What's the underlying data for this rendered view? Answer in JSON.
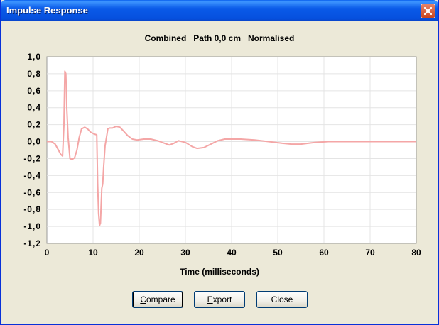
{
  "window": {
    "title": "Impulse Response"
  },
  "chart_header": "Combined   Path 0,0 cm   Normalised",
  "buttons": {
    "compare": {
      "label": "Compare",
      "accel": "C",
      "rest": "ompare"
    },
    "export": {
      "label": "Export",
      "accel": "E",
      "rest": "xport"
    },
    "close": {
      "label": "Close"
    }
  },
  "colors": {
    "titlebar": "#0a5ae8",
    "dialog_bg": "#ece9d8",
    "trace": "#f4a6a6",
    "grid": "#e4e4e4"
  },
  "icons": {
    "close": "close-x-icon"
  },
  "chart_data": {
    "type": "line",
    "xlabel": "Time (milliseconds)",
    "ylabel": "",
    "xlim": [
      0,
      80
    ],
    "ylim": [
      -1.2,
      1.0
    ],
    "x_ticks": [
      "0",
      "10",
      "20",
      "30",
      "40",
      "50",
      "60",
      "70",
      "80"
    ],
    "y_ticks": [
      "1,0",
      "0,8",
      "0,6",
      "0,4",
      "0,2",
      "0,0",
      "-0,2",
      "-0,4",
      "-0,6",
      "-0,8",
      "-1,0",
      "-1,2"
    ],
    "grid": true,
    "series": [
      {
        "x": [
          0,
          1,
          1.8,
          2.5,
          3,
          3.4,
          3.7,
          3.9,
          4.1,
          4.3,
          4.6,
          5.0,
          5.5,
          6.0,
          6.5,
          7.0,
          7.5,
          8.2,
          8.8,
          9.5,
          10.2,
          10.8,
          11.0,
          11.2,
          11.4,
          11.6,
          11.9,
          12.1,
          12.3,
          12.6,
          12.9,
          13.2,
          13.6,
          14.2,
          15.0,
          15.8,
          16.5,
          17.5,
          18.5,
          19.5,
          21.0,
          22.5,
          24.0,
          25.5,
          26.5,
          27.5,
          28.5,
          30.0,
          31.5,
          32.5,
          34.0,
          35.5,
          37.0,
          38.5,
          40.0,
          42.0,
          45.0,
          48.0,
          51.0,
          53.0,
          55.0,
          58.0,
          61.0,
          65.0,
          70.0,
          75.0,
          80.0
        ],
        "y": [
          0.0,
          0.0,
          -0.03,
          -0.1,
          -0.15,
          -0.17,
          0.2,
          0.83,
          0.8,
          0.4,
          0.05,
          -0.2,
          -0.21,
          -0.19,
          -0.1,
          0.05,
          0.15,
          0.17,
          0.15,
          0.11,
          0.09,
          0.08,
          -0.5,
          -0.85,
          -0.99,
          -0.96,
          -0.55,
          -0.5,
          -0.3,
          -0.05,
          0.05,
          0.15,
          0.16,
          0.16,
          0.18,
          0.17,
          0.13,
          0.07,
          0.03,
          0.02,
          0.03,
          0.03,
          0.01,
          -0.02,
          -0.04,
          -0.02,
          0.01,
          -0.01,
          -0.06,
          -0.08,
          -0.07,
          -0.03,
          0.01,
          0.03,
          0.03,
          0.03,
          0.02,
          0.0,
          -0.02,
          -0.03,
          -0.03,
          -0.01,
          0.0,
          0.0,
          0.0,
          0.0,
          0.0
        ]
      }
    ]
  }
}
